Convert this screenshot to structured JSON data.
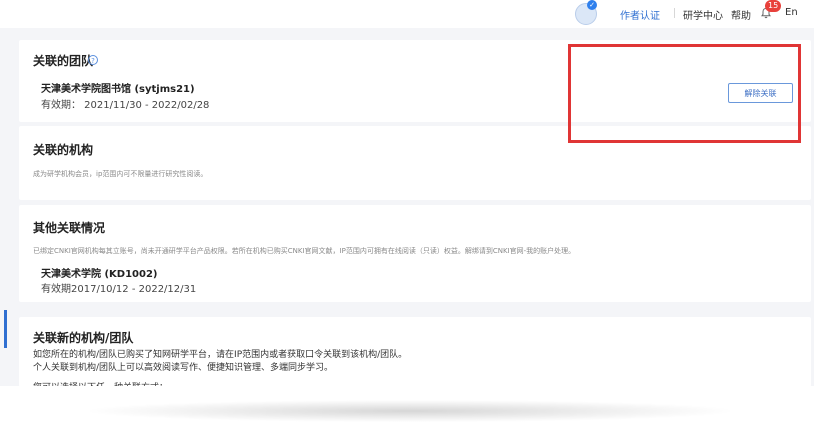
{
  "header": {
    "author_cert": "作者认证",
    "research_center": "研学中心",
    "help": "帮助",
    "notification_count": "15",
    "language": "En",
    "avatar_badge": "✓"
  },
  "team_panel": {
    "title": "关联的团队",
    "help_icon": "?",
    "org_name": "天津美术学院图书馆 (sytjms21)",
    "validity": "有效期：  2021/11/30 - 2022/02/28",
    "unlink_button": "解除关联"
  },
  "org_panel": {
    "title": "关联的机构",
    "description": "成为研学机构会员，ip范围内可不限量进行研究性阅读。"
  },
  "other_panel": {
    "title": "其他关联情况",
    "description": "已绑定CNKI官网机构每其立账号，尚未开通研学平台产品权限。若所在机构已购买CNKI官网文献，IP范围内可拥有在线阅读（只读）权益。解绑请到CNKI官网-我的账户处理。",
    "org_name": "天津美术学院 (KD1002)",
    "validity": "有效期2017/10/12 - 2022/12/31"
  },
  "new_link_panel": {
    "title": "关联新的机构/团队",
    "line1": "如您所在的机构/团队已购买了知网研学平台，请在IP范围内或者获取口令关联到该机构/团队。",
    "line2": "个人关联到机构/团队上可以高效阅读写作、便捷知识管理、多端同步学习。",
    "line3": "您可以选择以下任一种关联方式："
  },
  "annotation": {
    "highlight_color": "#e03535"
  }
}
